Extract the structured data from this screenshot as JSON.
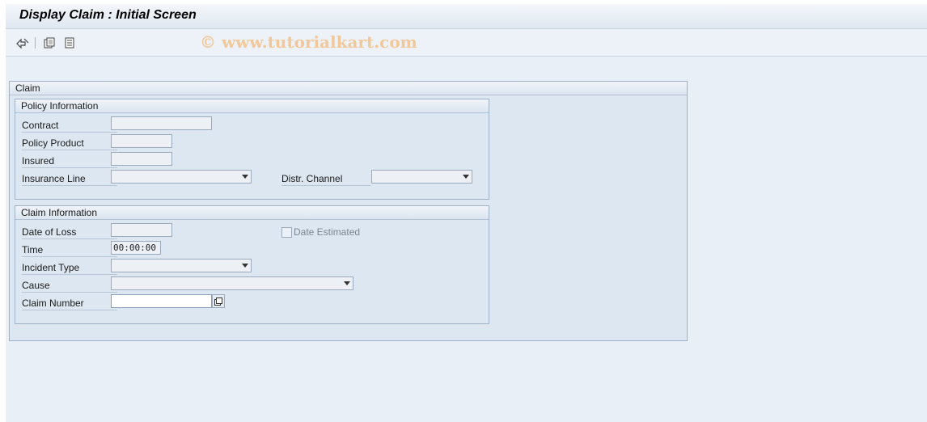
{
  "window": {
    "title": "Display Claim : Initial Screen"
  },
  "toolbar": {
    "watermark": "© www.tutorialkart.com",
    "icons": [
      "other-object-icon",
      "document-icon",
      "list-icon"
    ]
  },
  "claim": {
    "title": "Claim",
    "policy": {
      "title": "Policy Information",
      "contract_label": "Contract",
      "policy_product_label": "Policy Product",
      "insured_label": "Insured",
      "insurance_line_label": "Insurance Line",
      "distr_channel_label": "Distr. Channel",
      "contract_value": "",
      "policy_product_value": "",
      "insured_value": "",
      "insurance_line_value": "",
      "distr_channel_value": ""
    },
    "claim_info": {
      "title": "Claim Information",
      "date_of_loss_label": "Date of Loss",
      "time_label": "Time",
      "incident_type_label": "Incident Type",
      "cause_label": "Cause",
      "claim_number_label": "Claim Number",
      "date_estimated_label": "Date Estimated",
      "date_of_loss_value": "",
      "time_value": "00:00:00",
      "incident_type_value": "",
      "cause_value": "",
      "claim_number_value": ""
    }
  }
}
